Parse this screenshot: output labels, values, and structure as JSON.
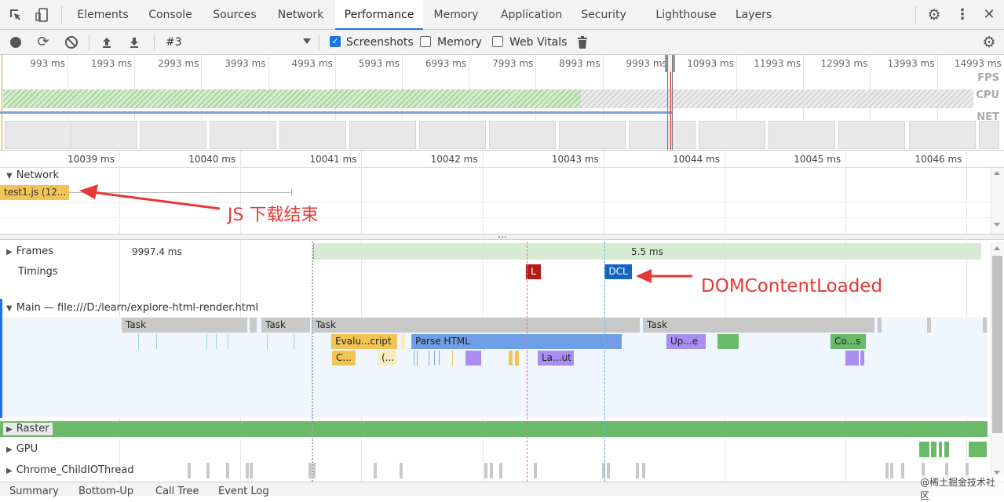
{
  "tabbar": {
    "tabs": [
      {
        "label": "Elements"
      },
      {
        "label": "Console"
      },
      {
        "label": "Sources"
      },
      {
        "label": "Network"
      },
      {
        "label": "Performance",
        "active": true
      },
      {
        "label": "Memory"
      },
      {
        "label": "Application"
      },
      {
        "label": "Security"
      },
      {
        "label": "Lighthouse"
      },
      {
        "label": "Layers"
      }
    ],
    "icons": [
      "inspect-icon",
      "device-toggle-icon",
      "settings-icon",
      "more-icon",
      "close-icon"
    ]
  },
  "toolbar": {
    "profile_select": "#3",
    "checkboxes": [
      {
        "label": "Screenshots",
        "checked": true
      },
      {
        "label": "Memory",
        "checked": false
      },
      {
        "label": "Web Vitals",
        "checked": false
      }
    ]
  },
  "overview": {
    "ticks": [
      "993 ms",
      "1993 ms",
      "2993 ms",
      "3993 ms",
      "4993 ms",
      "5993 ms",
      "6993 ms",
      "7993 ms",
      "8993 ms",
      "9993 ms",
      "10993 ms",
      "11993 ms",
      "12993 ms",
      "13993 ms",
      "14993 ms"
    ],
    "labels": {
      "fps": "FPS",
      "cpu": "CPU",
      "net": "NET"
    }
  },
  "ruler": {
    "ticks": [
      "10039 ms",
      "10040 ms",
      "10041 ms",
      "10042 ms",
      "10043 ms",
      "10044 ms",
      "10045 ms",
      "10046 ms"
    ]
  },
  "network": {
    "title": "Network",
    "request": "test1.js (12..."
  },
  "tracks": {
    "frames": {
      "title": "Frames",
      "value1": "9997.4 ms",
      "value2": "5.5 ms"
    },
    "timings": {
      "title": "Timings",
      "l_marker": "L",
      "dcl_marker": "DCL"
    },
    "main": {
      "title": "Main — file:///D:/learn/explore-html-render.html",
      "tasks": [
        "Task",
        "Task",
        "Task",
        "Task"
      ],
      "events": {
        "evaluate": "Evalu...cript",
        "parse": "Parse HTML",
        "update": "Up...e",
        "composite": "Co...s",
        "compile": "C...",
        "anon": "(...",
        "layout": "La...ut"
      }
    },
    "raster": {
      "title": "Raster"
    },
    "gpu": {
      "title": "GPU"
    },
    "child_io": {
      "title": "Chrome_ChildIOThread"
    }
  },
  "annotations": {
    "js_done": "JS 下载结束",
    "dcl": "DOMContentLoaded"
  },
  "watermark": "@稀土掘金技术社区",
  "bottom_tabs": [
    "Summary",
    "Bottom-Up",
    "Call Tree",
    "Event Log"
  ],
  "colors": {
    "accent": "#1a73e8",
    "annotation_red": "#e53935",
    "load_marker": "#b71c1c",
    "dcl_marker": "#1565c0",
    "raster_green": "#6aba6a"
  }
}
